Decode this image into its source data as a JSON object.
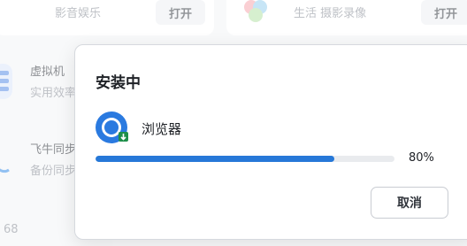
{
  "background": {
    "top_left_card": {
      "subtitle": "影音娱乐",
      "button": "打开"
    },
    "top_right_card": {
      "subtitle": "生活 摄影录像",
      "button": "打开"
    },
    "rows": [
      {
        "title": "虚拟机",
        "subtitle": "实用效率"
      },
      {
        "title": "飞牛同步",
        "subtitle": "备份同步"
      }
    ],
    "footer_number": "68"
  },
  "dialog": {
    "title": "安装中",
    "package": {
      "name": "浏览器",
      "icon": "chromium-browser-icon"
    },
    "progress": {
      "percent": 80,
      "label": "80%"
    },
    "cancel_label": "取消"
  },
  "colors": {
    "accent": "#2678d8",
    "track": "#e9ebee"
  }
}
